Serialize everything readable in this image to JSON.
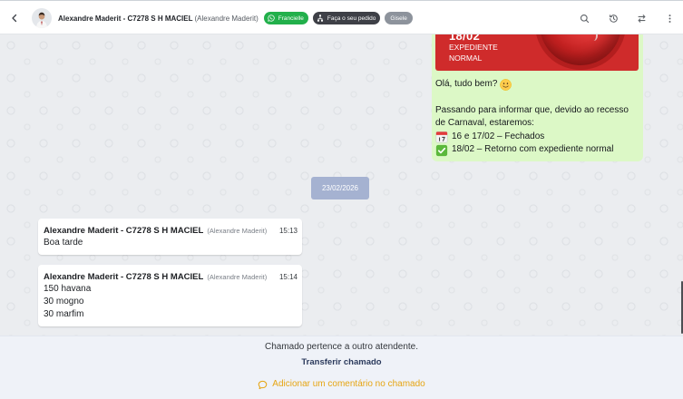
{
  "header": {
    "back_icon": "chevron-left-icon",
    "avatar_icon": "person-avatar-icon",
    "contact_name": "Alexandre Maderit - C7278 S H MACIEL",
    "contact_alias": "(Alexandre Maderit)",
    "tags": [
      {
        "label": "Francielle",
        "icon": "whatsapp-icon",
        "color": "#22b04b"
      },
      {
        "label": "Faça o seu pedido",
        "icon": "flow-icon",
        "color": "#3e4047"
      },
      {
        "label": "Gisele",
        "color": "#8d939c"
      }
    ],
    "actions": [
      "search-icon",
      "history-icon",
      "swap-icon",
      "more-vertical-icon"
    ]
  },
  "chat": {
    "outgoing": {
      "image": {
        "lines": [
          "18/02",
          "EXPEDIENTE",
          "NORMAL"
        ],
        "color": "#cf2b2b"
      },
      "greeting": "Olá, tudo bem?",
      "greeting_emoji": "slightly-smiling-face-emoji",
      "paragraph_lines": [
        "Passando para informar que, devido ao recesso",
        "de Carnaval, estaremos:"
      ],
      "schedule": [
        {
          "emoji": "calendar-emoji",
          "text": "16 e 17/02 – Fechados"
        },
        {
          "emoji": "check-mark-button-emoji",
          "text": "18/02 – Retorno com expediente normal"
        }
      ]
    },
    "date_divider": "23/02/2026",
    "incoming": [
      {
        "sender": "Alexandre Maderit - C7278 S H MACIEL",
        "alias": "(Alexandre Maderit)",
        "time": "15:13",
        "lines": [
          "Boa tarde"
        ]
      },
      {
        "sender": "Alexandre Maderit - C7278 S H MACIEL",
        "alias": "(Alexandre Maderit)",
        "time": "15:14",
        "lines": [
          "150 havana",
          "30 mogno",
          "30 marfim"
        ]
      }
    ]
  },
  "footer": {
    "notice": "Chamado pertence a outro atendente.",
    "transfer_label": "Transferir chamado",
    "comment_icon": "comment-icon",
    "comment_label": "Adicionar um comentário no chamado"
  },
  "theme": {
    "outgoing_bubble": "#dcf8c6",
    "date_chip": "#a5b2d1",
    "transfer_link": "#2b3a5c",
    "comment_link": "#e6a513"
  }
}
